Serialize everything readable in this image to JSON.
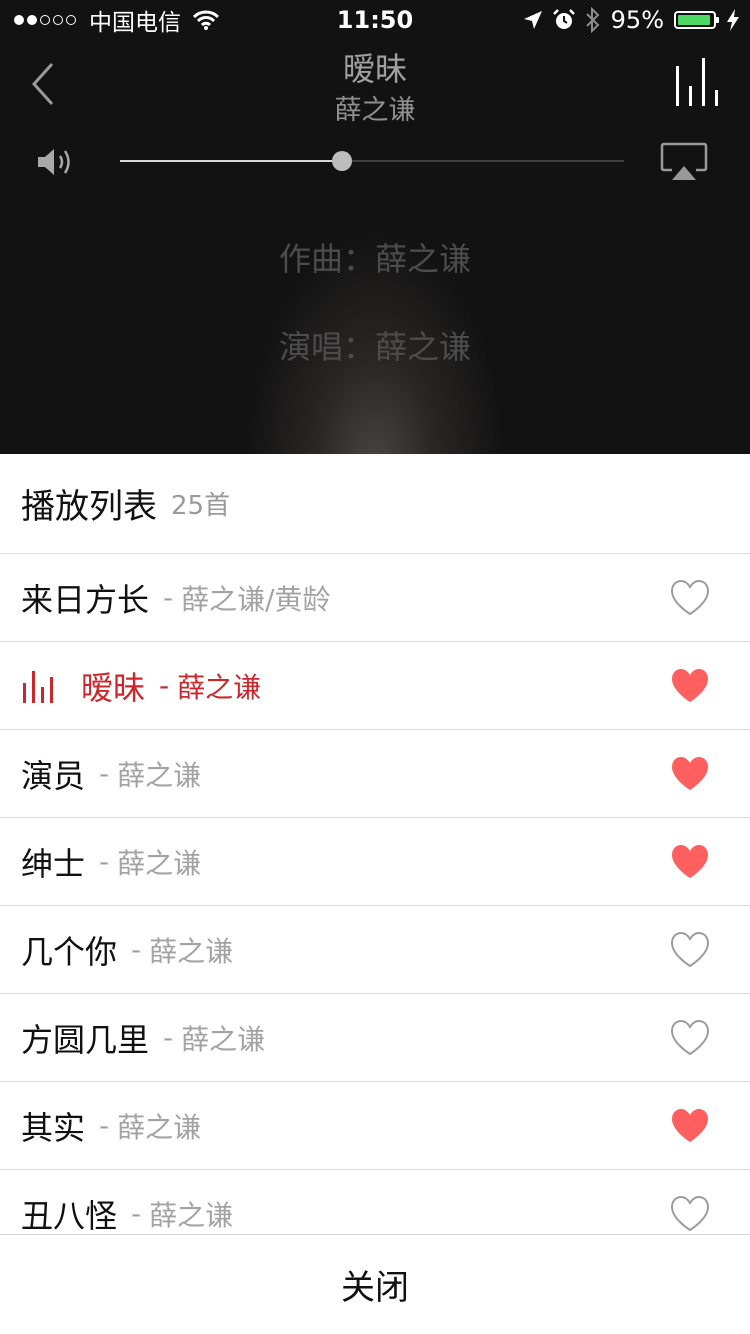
{
  "status_bar": {
    "carrier": "中国电信",
    "time": "11:50",
    "battery_percent_text": "95%",
    "battery_level": 0.95,
    "signal_bars_filled": 2,
    "signal_bars_total": 5,
    "battery_color": "#4cd964",
    "icons": [
      "wifi-icon",
      "location-arrow-icon",
      "alarm-icon",
      "bluetooth-icon",
      "battery-icon",
      "charging-bolt-icon"
    ]
  },
  "now_playing": {
    "title": "暧昧",
    "artist": "薛之谦",
    "volume_level": 0.44,
    "lyrics": [
      "作曲：薛之谦",
      "演唱：薛之谦"
    ]
  },
  "playlist": {
    "title": "播放列表",
    "count": "25首",
    "accent_color": "#c9282d",
    "heart_color": "#ff5f5f",
    "songs": [
      {
        "name": "来日方长",
        "sep": "-",
        "singer": "薛之谦/黄龄",
        "liked": false,
        "playing": false
      },
      {
        "name": "暧昧",
        "sep": "-",
        "singer": "薛之谦",
        "liked": true,
        "playing": true
      },
      {
        "name": "演员",
        "sep": "-",
        "singer": "薛之谦",
        "liked": true,
        "playing": false
      },
      {
        "name": "绅士",
        "sep": "-",
        "singer": "薛之谦",
        "liked": true,
        "playing": false
      },
      {
        "name": "几个你",
        "sep": "-",
        "singer": "薛之谦",
        "liked": false,
        "playing": false
      },
      {
        "name": "方圆几里",
        "sep": "-",
        "singer": "薛之谦",
        "liked": false,
        "playing": false
      },
      {
        "name": "其实",
        "sep": "-",
        "singer": "薛之谦",
        "liked": true,
        "playing": false
      },
      {
        "name": "丑八怪",
        "sep": "-",
        "singer": "薛之谦",
        "liked": false,
        "playing": false
      }
    ]
  },
  "close_label": "关闭"
}
